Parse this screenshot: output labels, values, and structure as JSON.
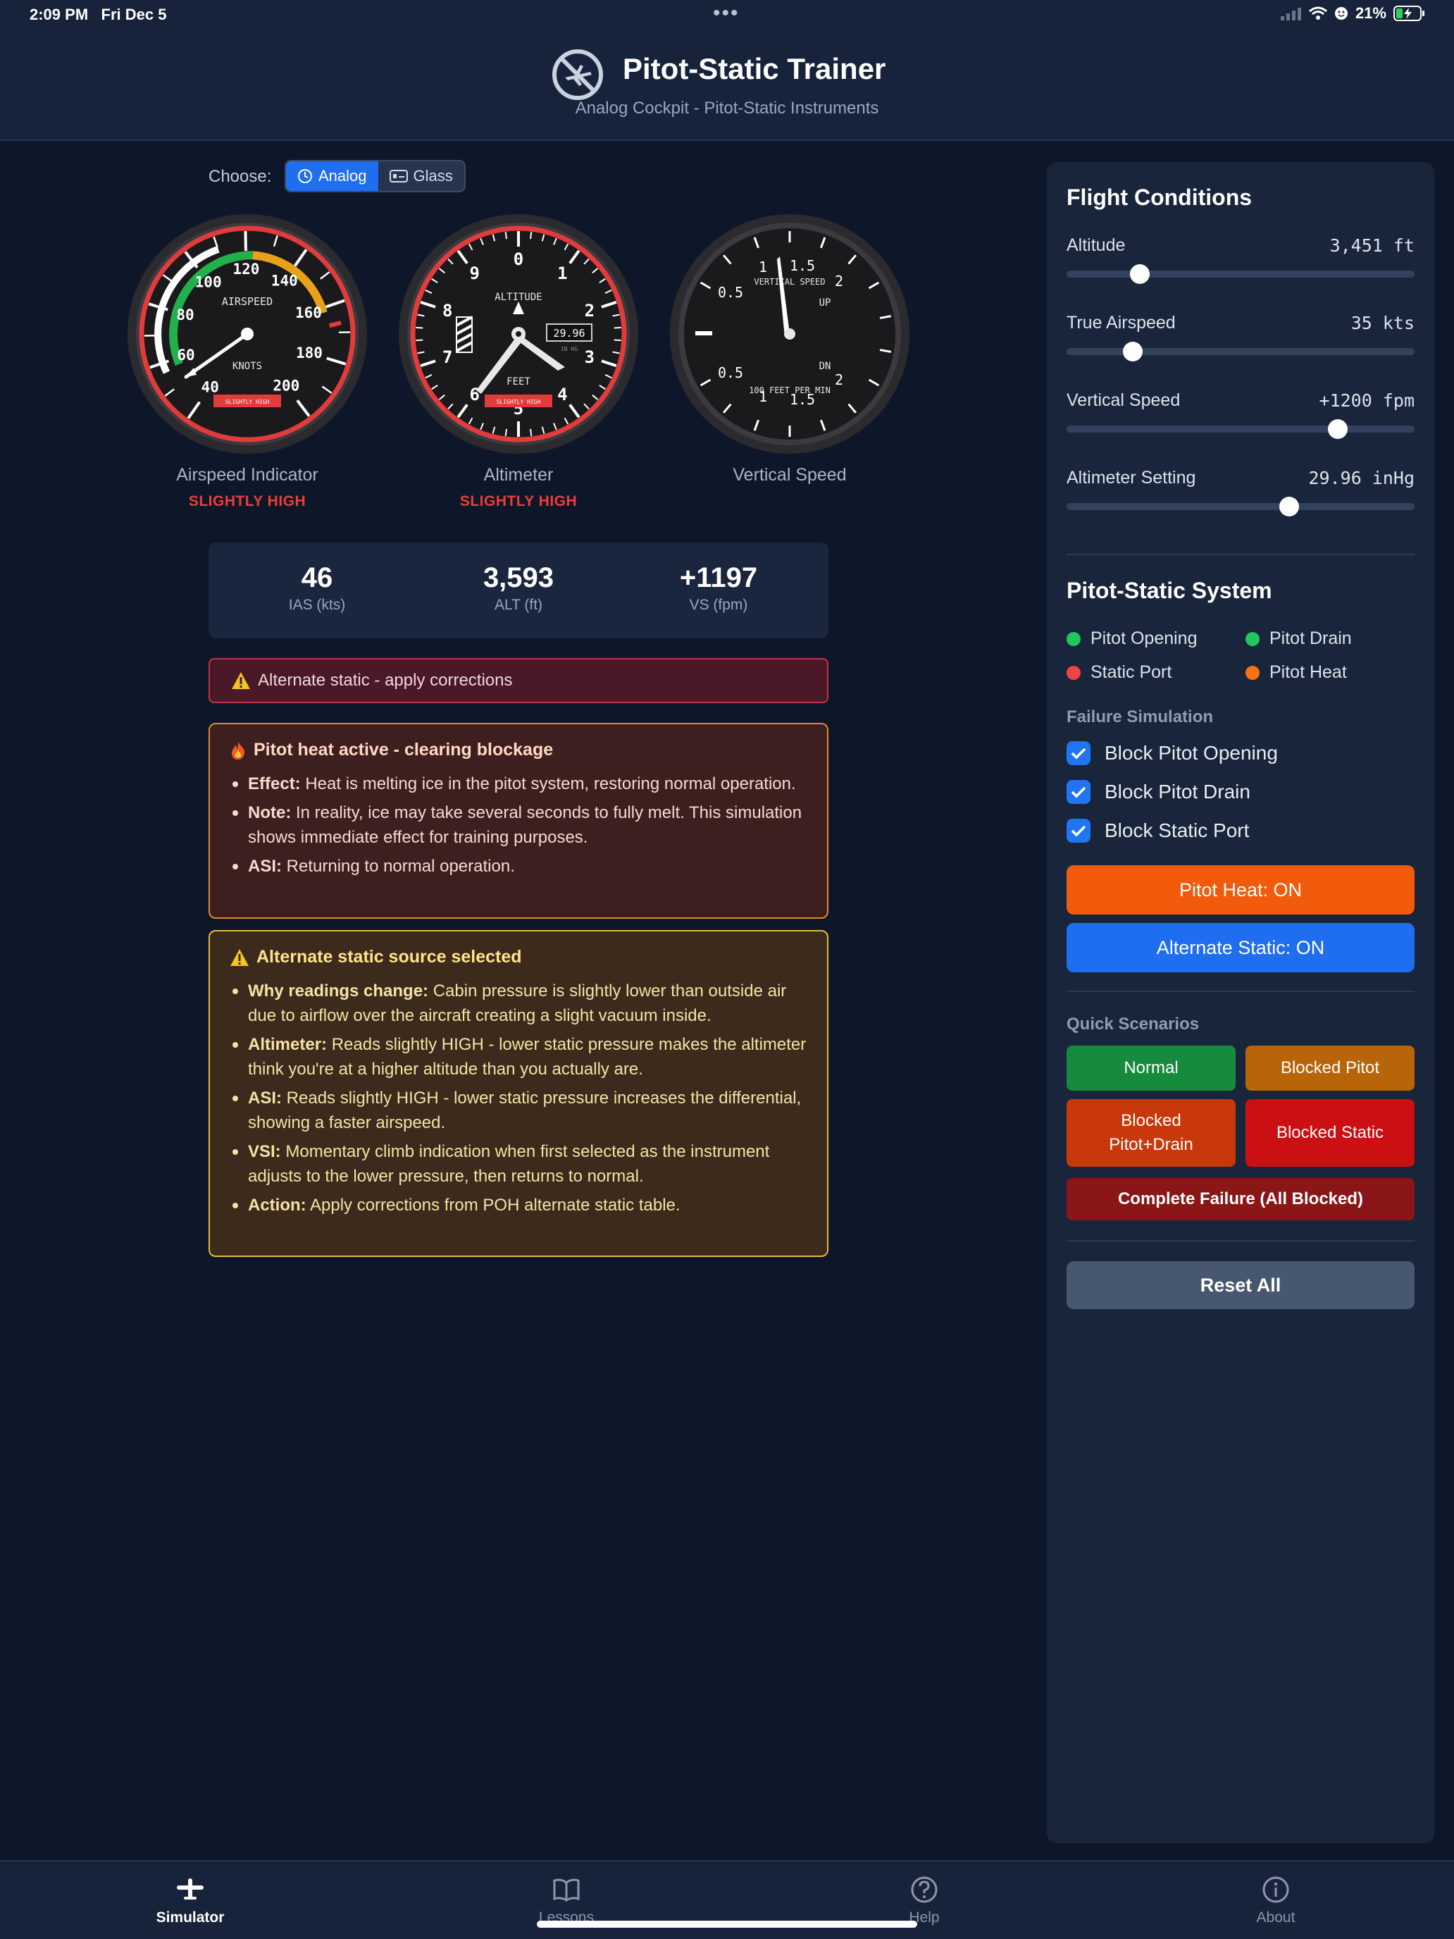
{
  "status_bar": {
    "time": "2:09 PM",
    "date": "Fri Dec 5",
    "battery": "21%"
  },
  "header": {
    "title": "Pitot-Static Trainer",
    "subtitle": "Analog Cockpit - Pitot-Static Instruments"
  },
  "chooser": {
    "label": "Choose:",
    "options": [
      "Analog",
      "Glass"
    ],
    "selected": "Analog"
  },
  "gauges": {
    "airspeed": {
      "label": "Airspeed Indicator",
      "status": "SLIGHTLY HIGH",
      "face_title": "AIRSPEED",
      "face_unit": "KNOTS",
      "flag": "SLIGHTLY HIGH",
      "ticks": [
        "40",
        "60",
        "80",
        "100",
        "120",
        "140",
        "160",
        "180",
        "200"
      ],
      "needle_value_kts": 46
    },
    "altimeter": {
      "label": "Altimeter",
      "status": "SLIGHTLY HIGH",
      "face_title": "ALTITUDE",
      "face_unit": "FEET",
      "flag": "SLIGHTLY HIGH",
      "digits": [
        "0",
        "1",
        "2",
        "3",
        "4",
        "5",
        "6",
        "7",
        "8",
        "9"
      ],
      "kollsman": "29.96",
      "kollsman_unit": "IN HG",
      "value_ft": 3593
    },
    "vsi": {
      "label": "Vertical Speed",
      "face_title": "VERTICAL SPEED",
      "face_unit": "100 FEET PER MIN",
      "up": "UP",
      "dn": "DN",
      "ticks": [
        "0.5",
        "1",
        "1.5",
        "2"
      ],
      "value_fpm": 1197
    }
  },
  "readouts": [
    {
      "value": "46",
      "label": "IAS (kts)"
    },
    {
      "value": "3,593",
      "label": "ALT (ft)"
    },
    {
      "value": "+1197",
      "label": "VS (fpm)"
    }
  ],
  "banner": {
    "icon": "warning-icon",
    "text": "Alternate static - apply corrections"
  },
  "heat_box": {
    "icon": "fire-icon",
    "title": "Pitot heat active - clearing blockage",
    "items": [
      {
        "key": "Effect:",
        "text": " Heat is melting ice in the pitot system, restoring normal operation."
      },
      {
        "key": "Note:",
        "text": " In reality, ice may take several seconds to fully melt. This simulation shows immediate effect for training purposes."
      },
      {
        "key": "ASI:",
        "text": " Returning to normal operation."
      }
    ]
  },
  "alt_box": {
    "icon": "warning-icon",
    "title": "Alternate static source selected",
    "items": [
      {
        "key": "Why readings change:",
        "text": " Cabin pressure is slightly lower than outside air due to airflow over the aircraft creating a slight vacuum inside."
      },
      {
        "key": "Altimeter:",
        "text": " Reads slightly HIGH - lower static pressure makes the altimeter think you're at a higher altitude than you actually are."
      },
      {
        "key": "ASI:",
        "text": " Reads slightly HIGH - lower static pressure increases the differential, showing a faster airspeed."
      },
      {
        "key": "VSI:",
        "text": " Momentary climb indication when first selected as the instrument adjusts to the lower pressure, then returns to normal."
      },
      {
        "key": "Action:",
        "text": " Apply corrections from POH alternate static table."
      }
    ]
  },
  "flight_conditions": {
    "title": "Flight Conditions",
    "sliders": [
      {
        "label": "Altitude",
        "value": "3,451 ft",
        "fraction": 0.21
      },
      {
        "label": "True Airspeed",
        "value": "35 kts",
        "fraction": 0.19
      },
      {
        "label": "Vertical Speed",
        "value": "+1200 fpm",
        "fraction": 0.78
      },
      {
        "label": "Altimeter Setting",
        "value": "29.96 inHg",
        "fraction": 0.64
      }
    ]
  },
  "pitot_static": {
    "title": "Pitot-Static System",
    "legend": [
      {
        "label": "Pitot Opening",
        "color": "#22c55e"
      },
      {
        "label": "Pitot Drain",
        "color": "#22c55e"
      },
      {
        "label": "Static Port",
        "color": "#ef4444"
      },
      {
        "label": "Pitot Heat",
        "color": "#f97316"
      }
    ],
    "failure_title": "Failure Simulation",
    "checks": [
      {
        "label": "Block Pitot Opening",
        "checked": true
      },
      {
        "label": "Block Pitot Drain",
        "checked": true
      },
      {
        "label": "Block Static Port",
        "checked": true
      }
    ],
    "pitot_heat_button": "Pitot Heat: ON",
    "alt_static_button": "Alternate Static: ON"
  },
  "scenarios": {
    "title": "Quick Scenarios",
    "normal": "Normal",
    "blocked_pitot": "Blocked Pitot",
    "blocked_pitot_drain_1": "Blocked",
    "blocked_pitot_drain_2": "Pitot+Drain",
    "blocked_static": "Blocked Static",
    "complete_failure": "Complete Failure (All Blocked)"
  },
  "reset_button": "Reset All",
  "tabs": [
    {
      "label": "Simulator",
      "icon": "airplane-icon",
      "active": true
    },
    {
      "label": "Lessons",
      "icon": "book-icon",
      "active": false
    },
    {
      "label": "Help",
      "icon": "help-icon",
      "active": false
    },
    {
      "label": "About",
      "icon": "info-icon",
      "active": false
    }
  ],
  "colors": {
    "accent": "#1f6ef0",
    "danger": "#ef3b3b",
    "heat": "#f25a0c",
    "warning": "#e6b93a"
  }
}
